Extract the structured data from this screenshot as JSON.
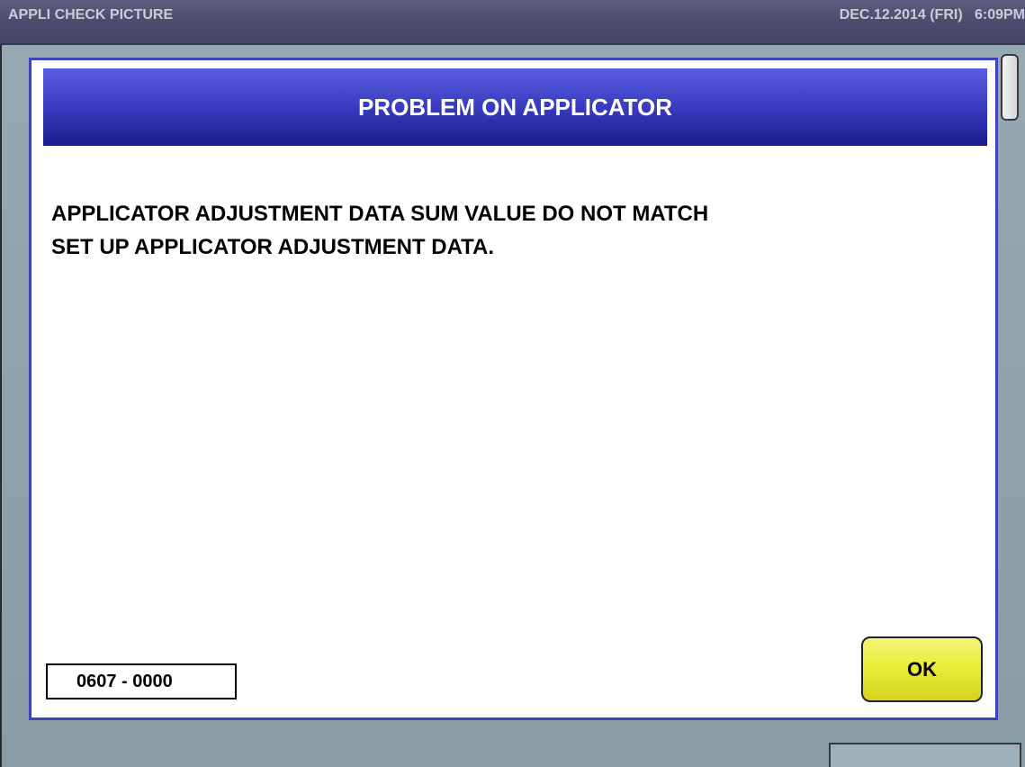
{
  "title_bar": {
    "app_title": "APPLI CHECK PICTURE",
    "datetime": "DEC.12.2014 (FRI)   6:09PM"
  },
  "dialog": {
    "title": "PROBLEM ON APPLICATOR",
    "message_lines": [
      "APPLICATOR ADJUSTMENT DATA SUM VALUE DO NOT MATCH",
      "SET UP APPLICATOR ADJUSTMENT DATA."
    ],
    "error_code": "0607 - 0000",
    "ok_label": "OK"
  },
  "colors": {
    "header_blue": "#3c3fc2",
    "ok_yellow": "#ecec3a",
    "dialog_border": "#3d43b8",
    "title_bar": "#4c4d6e",
    "desktop": "#8a9ca6"
  }
}
